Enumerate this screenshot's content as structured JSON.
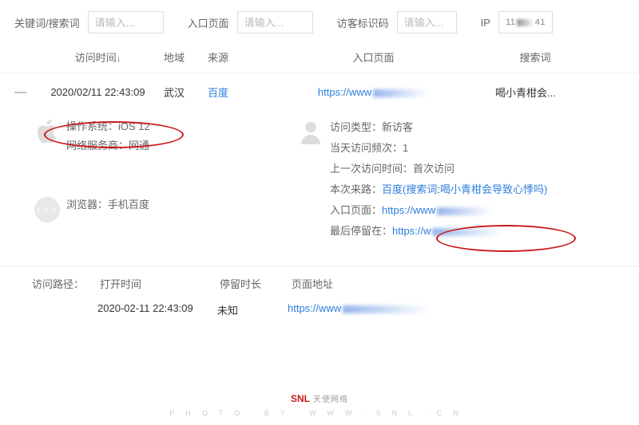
{
  "filters": {
    "keyword_label": "关键词/搜索词",
    "keyword_placeholder": "请输入...",
    "entry_label": "入口页面",
    "entry_placeholder": "请输入...",
    "visitor_id_label": "访客标识码",
    "visitor_id_placeholder": "请输入...",
    "ip_label": "IP",
    "ip_value": "11               41"
  },
  "table": {
    "headers": {
      "time": "访问时间",
      "sort_indicator": "↓",
      "region": "地域",
      "source": "来源",
      "entry": "入口页面",
      "search": "搜索词"
    },
    "row": {
      "toggle": "—",
      "time": "2020/02/11 22:43:09",
      "region": "武汉",
      "source": "百度",
      "entry_url": "https://www",
      "search": "喝小青柑会..."
    }
  },
  "detail": {
    "left": {
      "os_label": "操作系统：",
      "os_value": "iOS 12",
      "isp_label": "网络服务商：",
      "isp_value": "网通",
      "browser_label": "浏览器：",
      "browser_value": "手机百度"
    },
    "right": {
      "visitor_type_label": "访问类型：",
      "visitor_type_value": "新访客",
      "day_visits_label": "当天访问频次：",
      "day_visits_value": "1",
      "last_visit_label": "上一次访问时间：",
      "last_visit_value": "首次访问",
      "route_label": "本次来路：",
      "route_source": "百度",
      "route_paren_open": "(",
      "route_search_label": "搜索词",
      "route_search_value": "喝小青柑会导致心悸吗",
      "route_paren_close": ")",
      "entry_label": "入口页面：",
      "entry_value": "https://www",
      "last_stay_label": "最后停留在：",
      "last_stay_value": "https://w"
    }
  },
  "path": {
    "section_label": "访问路径：",
    "headers": {
      "open_time": "打开时间",
      "duration": "停留时长",
      "url": "页面地址"
    },
    "row": {
      "open_time": "2020-02-11 22:43:09",
      "duration": "未知",
      "url": "https://www"
    }
  },
  "footer": {
    "brand": "SNL",
    "brand_cn": "天使网络",
    "line2": "PHOTO BY WWW.SNL.CN"
  }
}
